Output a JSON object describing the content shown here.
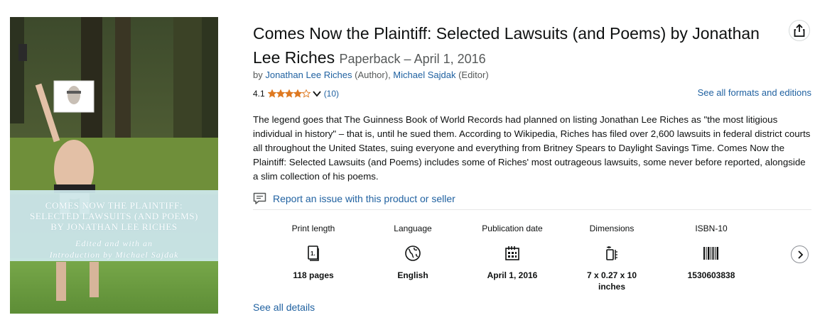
{
  "cover": {
    "title_lines": [
      "Comes Now the Plaintiff:",
      "Selected Lawsuits (and Poems)",
      "by Jonathan Lee Riches"
    ],
    "subtitle_lines": [
      "Edited and with an",
      "Introduction by Michael Sajdak"
    ]
  },
  "product": {
    "title": "Comes Now the Plaintiff: Selected Lawsuits (and Poems) by Jonathan Lee Riches",
    "format": "Paperback",
    "date_sep": " – ",
    "date": "April 1, 2016"
  },
  "byline": {
    "prefix": "by ",
    "author1": "Jonathan Lee Riches",
    "author1_role": " (Author), ",
    "author2": "Michael Sajdak",
    "author2_role": " (Editor)"
  },
  "rating": {
    "value": "4.1",
    "stars": 4.1,
    "count": "(10)",
    "star_color": "#de7921"
  },
  "formats_link": "See all formats and editions",
  "description": "The legend goes that The Guinness Book of World Records had planned on listing Jonathan Lee Riches as \"the most litigious individual in history\" – that is, until he sued them. According to Wikipedia, Riches has filed over 2,600 lawsuits in federal district courts all throughout the United States, suing everyone and everything from Britney Spears to Daylight Savings Time. Comes Now the Plaintiff: Selected Lawsuits (and Poems) includes some of Riches' most outrageous lawsuits, some never before reported, alongside a slim collection of his poems.",
  "report_link": "Report an issue with this product or seller",
  "details": [
    {
      "label": "Print length",
      "icon": "book-pages-icon",
      "value": "118 pages"
    },
    {
      "label": "Language",
      "icon": "globe-icon",
      "value": "English"
    },
    {
      "label": "Publication date",
      "icon": "calendar-icon",
      "value": "April 1, 2016"
    },
    {
      "label": "Dimensions",
      "icon": "ruler-dimensions-icon",
      "value": "7 x 0.27 x 10 inches"
    },
    {
      "label": "ISBN-10",
      "icon": "barcode-icon",
      "value": "1530603838"
    }
  ],
  "see_all_details": "See all details",
  "colors": {
    "link": "#2162a1",
    "text": "#0f1111",
    "muted": "#565959"
  }
}
